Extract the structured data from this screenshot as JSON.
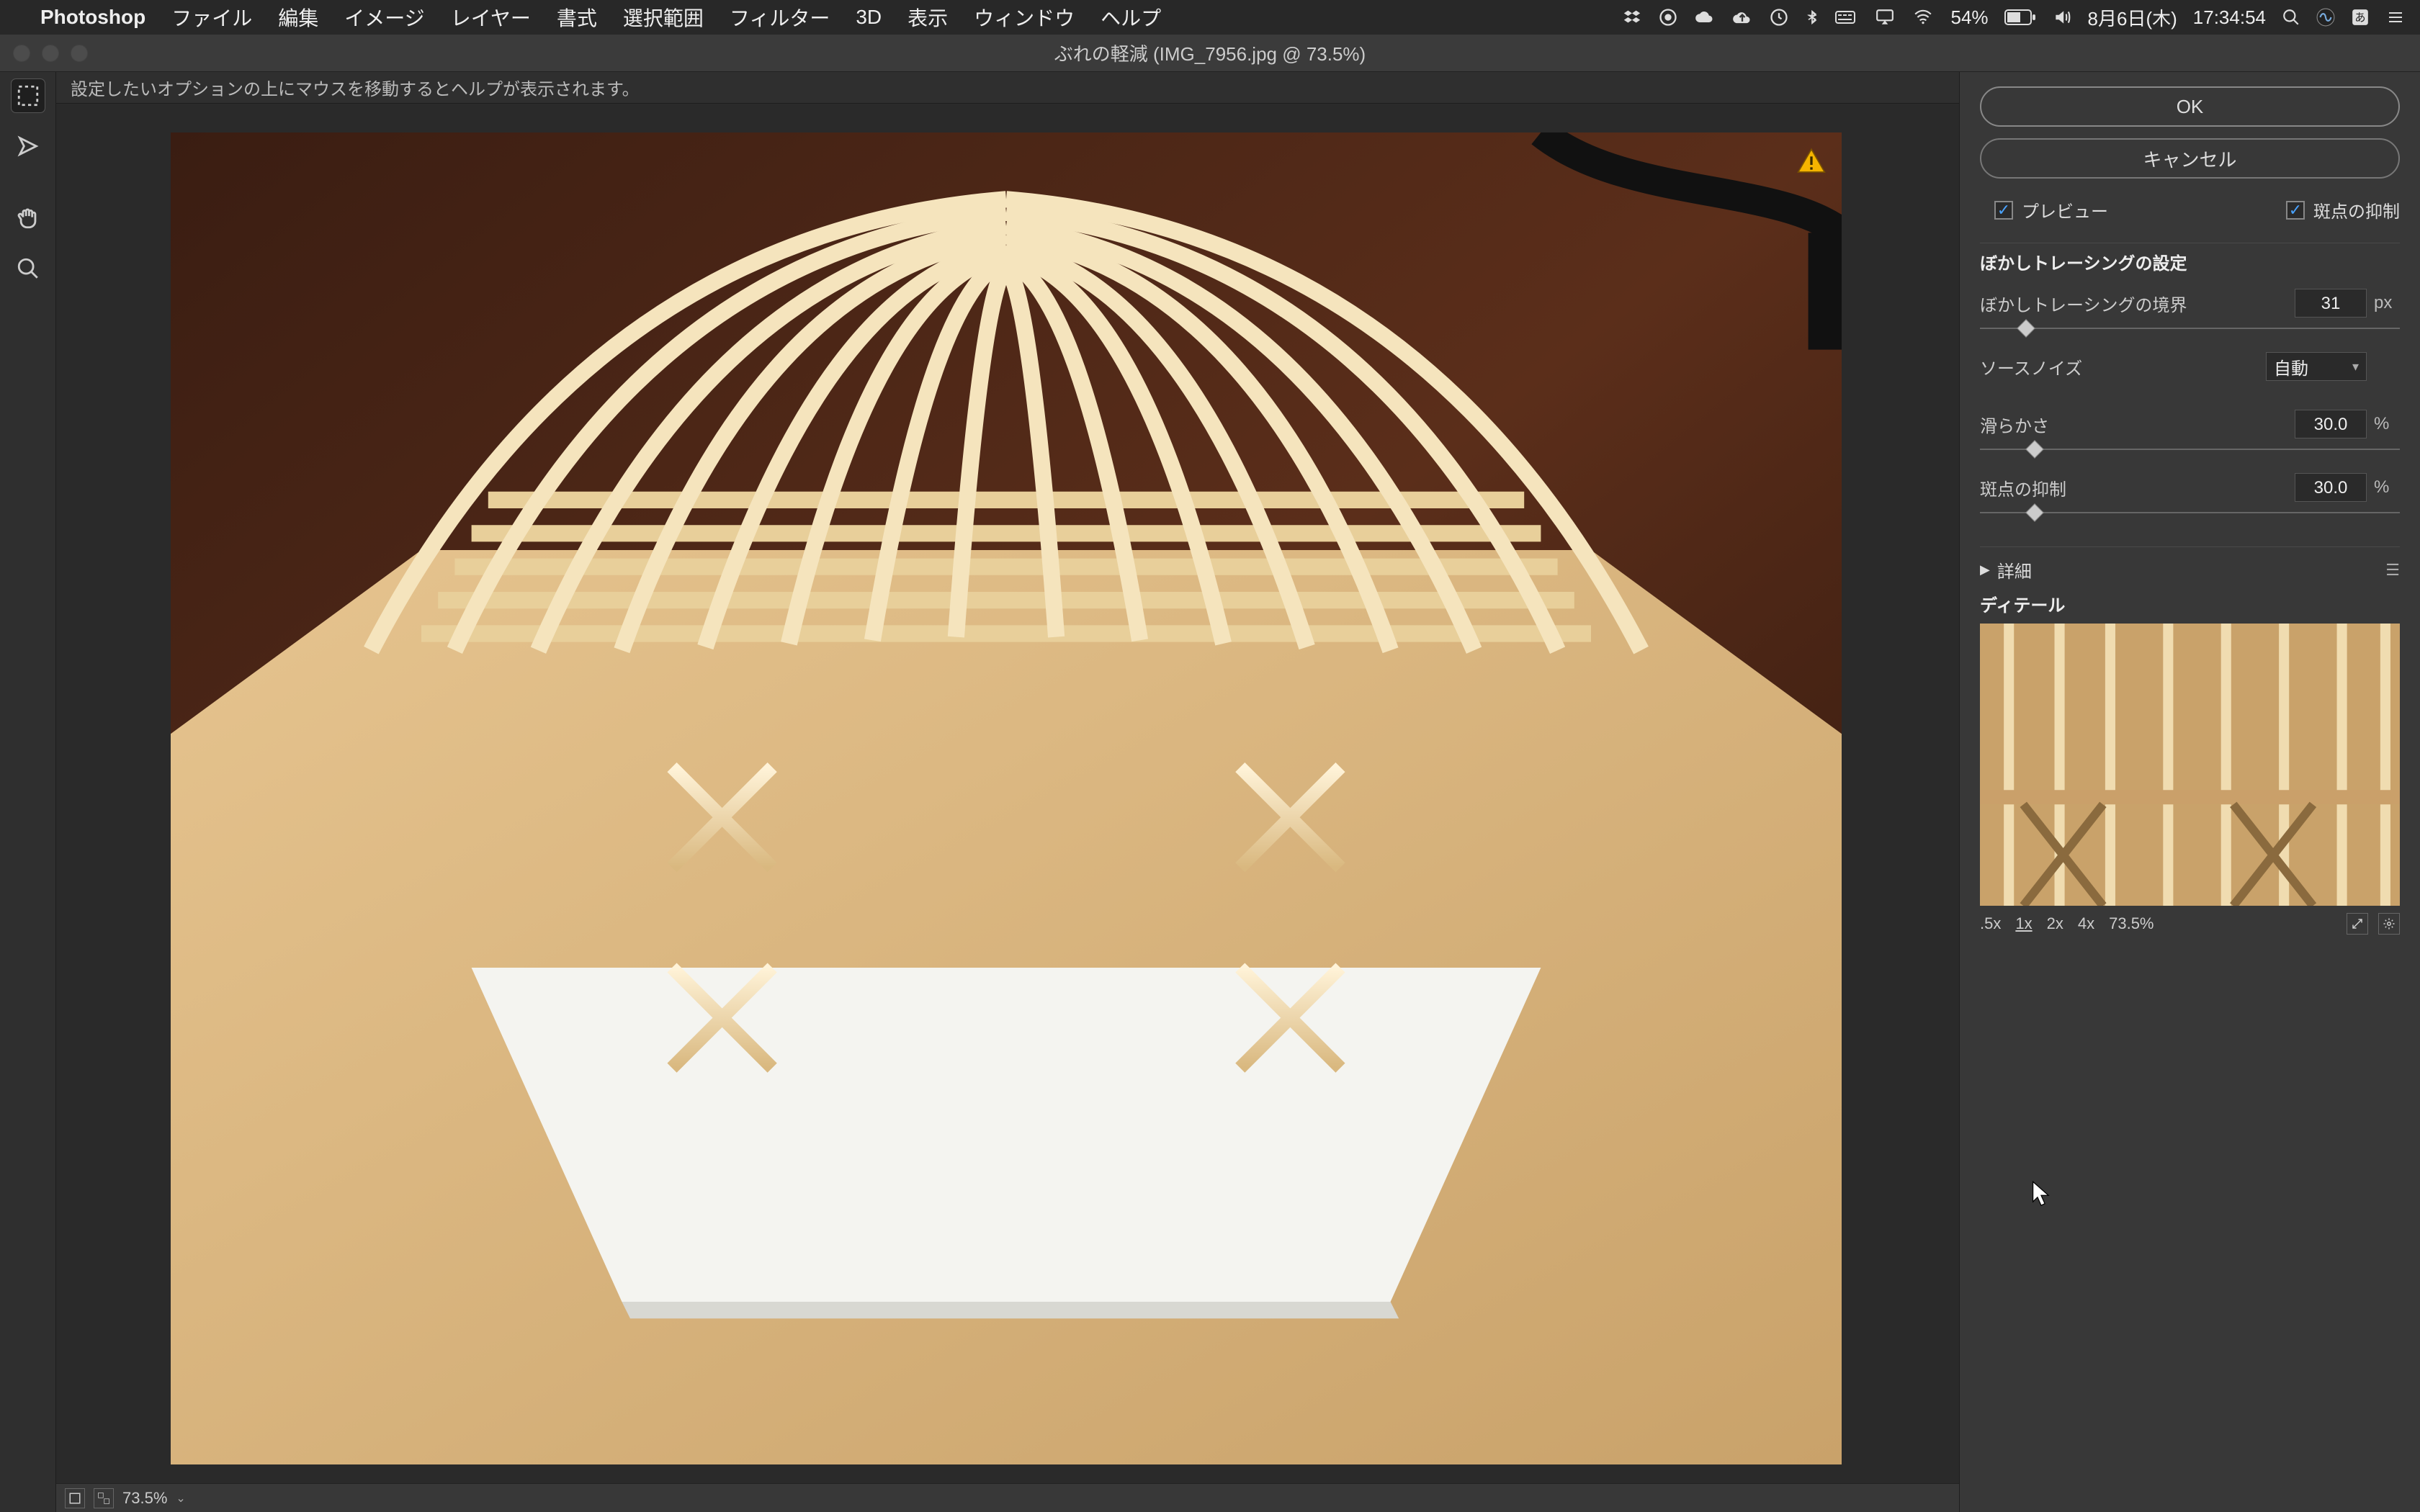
{
  "menubar": {
    "app": "Photoshop",
    "items": [
      "ファイル",
      "編集",
      "イメージ",
      "レイヤー",
      "書式",
      "選択範囲",
      "フィルター",
      "3D",
      "表示",
      "ウィンドウ",
      "ヘルプ"
    ],
    "battery_pct": "54%",
    "date": "8月6日(木)",
    "time": "17:34:54"
  },
  "window": {
    "title": "ぶれの軽減 (IMG_7956.jpg @ 73.5%)"
  },
  "options_bar": {
    "hint": "設定したいオプションの上にマウスを移動するとヘルプが表示されます。"
  },
  "canvas_status": {
    "zoom": "73.5%"
  },
  "panel": {
    "ok": "OK",
    "cancel": "キャンセル",
    "preview": "プレビュー",
    "artifact_suppress_chk": "斑点の抑制",
    "section_title": "ぼかしトレーシングの設定",
    "params": {
      "trace_bounds": {
        "label": "ぼかしトレーシングの境界",
        "value": "31",
        "unit": "px",
        "pos": 0.11
      },
      "source_noise": {
        "label": "ソースノイズ",
        "value": "自動"
      },
      "smoothness": {
        "label": "滑らかさ",
        "value": "30.0",
        "unit": "%",
        "pos": 0.3
      },
      "artifact": {
        "label": "斑点の抑制",
        "value": "30.0",
        "unit": "%",
        "pos": 0.3
      }
    },
    "advanced": "詳細",
    "detail": "ディテール",
    "zooms": [
      ".5x",
      "1x",
      "2x",
      "4x",
      "73.5%"
    ],
    "active_zoom": "1x"
  }
}
